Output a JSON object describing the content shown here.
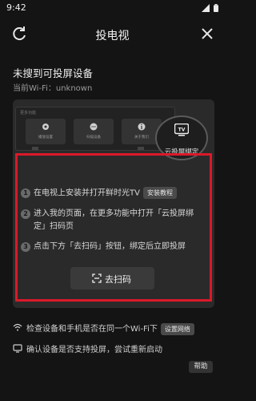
{
  "status_bar": {
    "time": "9:42"
  },
  "header": {
    "title": "投电视"
  },
  "notice": {
    "title": "未搜到可投屏设备",
    "wifi": "当前Wi-Fi：unknown"
  },
  "tv_preview": {
    "menu_title": "更多功能",
    "tiles": [
      "播放设置",
      "扫描设备",
      "关于我们"
    ],
    "cloud_label": "云投屏绑定",
    "cloud_icon_text": "TV"
  },
  "steps": [
    {
      "num": "1",
      "text": "在电视上安装并打开鲜时光TV",
      "pill": "安装教程"
    },
    {
      "num": "2",
      "text_line1": "进入我的页面，在更多功能中打开「云投屏绑",
      "text_line2": "定」扫码页"
    },
    {
      "num": "3",
      "text": "点击下方「去扫码」按钮，绑定后立即投屏"
    }
  ],
  "scan_button": {
    "label": "去扫码"
  },
  "tips": [
    {
      "text": "检查设备和手机是否在同一个Wi-Fi下",
      "pill": "设置网络",
      "icon": "wifi-icon"
    },
    {
      "text": "确认设备是否支持投屏，尝试重新启动",
      "icon": "screen-icon"
    }
  ],
  "help_button": {
    "label": "帮助"
  },
  "colors": {
    "background": "#141414",
    "panel": "#2a2a2a",
    "highlight_border": "#d9192a"
  }
}
